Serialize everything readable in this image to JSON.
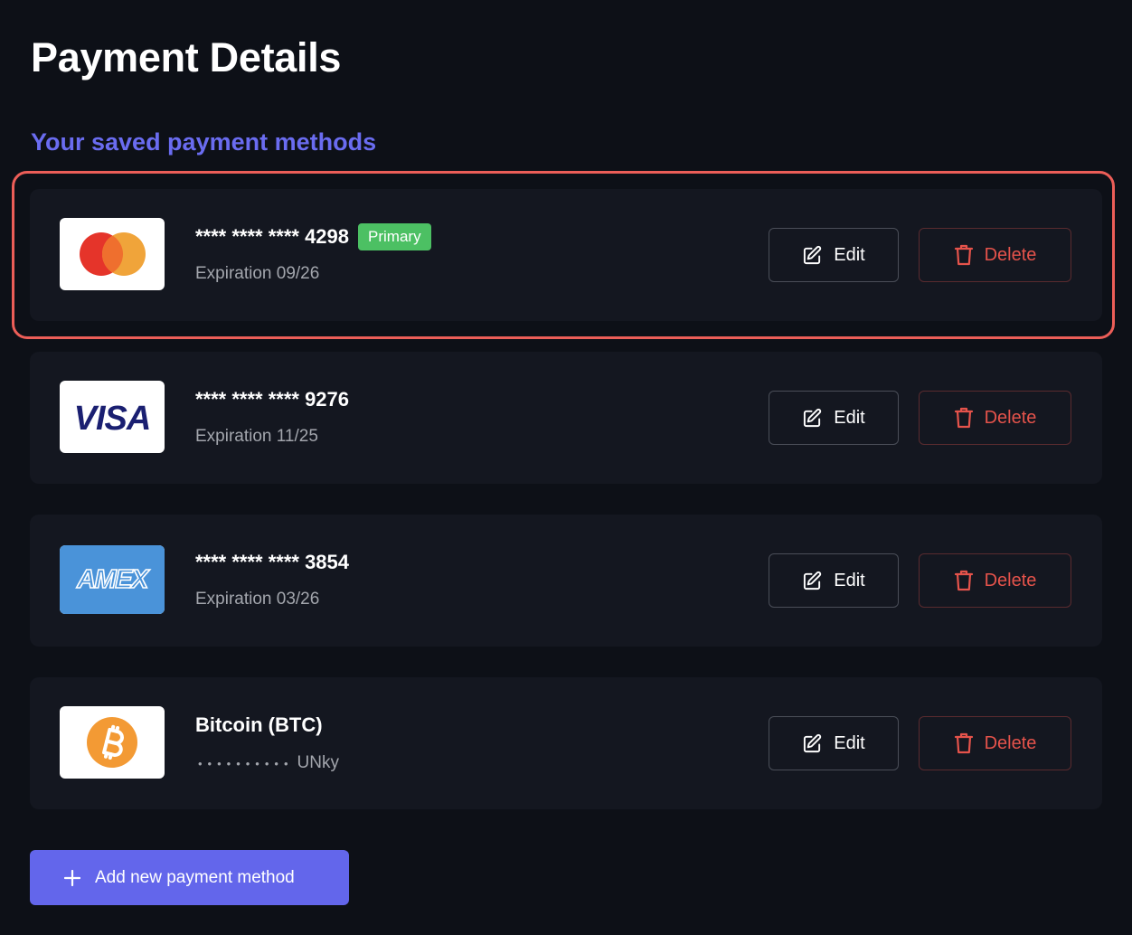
{
  "page": {
    "title": "Payment Details",
    "section_title": "Your saved payment methods"
  },
  "colors": {
    "background": "#0d1017",
    "card_background": "#141720",
    "accent": "#6366eb",
    "section_title": "#6a6cf0",
    "primary_badge": "#4cc063",
    "delete": "#e5534b",
    "selection_outline": "#ec5e58"
  },
  "payment_methods": [
    {
      "brand_icon": "mastercard-logo",
      "number": "**** **** **** 4298",
      "badge": "Primary",
      "detail": "Expiration 09/26",
      "selected": true,
      "edit_label": "Edit",
      "delete_label": "Delete"
    },
    {
      "brand_icon": "visa-logo",
      "brand_text": "VISA",
      "number": "**** **** **** 9276",
      "detail": "Expiration 11/25",
      "edit_label": "Edit",
      "delete_label": "Delete"
    },
    {
      "brand_icon": "amex-logo",
      "brand_text": "AMEX",
      "number": "**** **** **** 3854",
      "detail": "Expiration 03/26",
      "edit_label": "Edit",
      "delete_label": "Delete"
    },
    {
      "brand_icon": "bitcoin-logo",
      "name": "Bitcoin (BTC)",
      "detail_dots": "••••••••••",
      "detail_suffix": "UNky",
      "edit_label": "Edit",
      "delete_label": "Delete"
    }
  ],
  "icons": {
    "edit": "pencil-square-icon",
    "delete": "trash-icon",
    "add": "plus-icon"
  },
  "add_button": {
    "label": "Add new payment method"
  }
}
